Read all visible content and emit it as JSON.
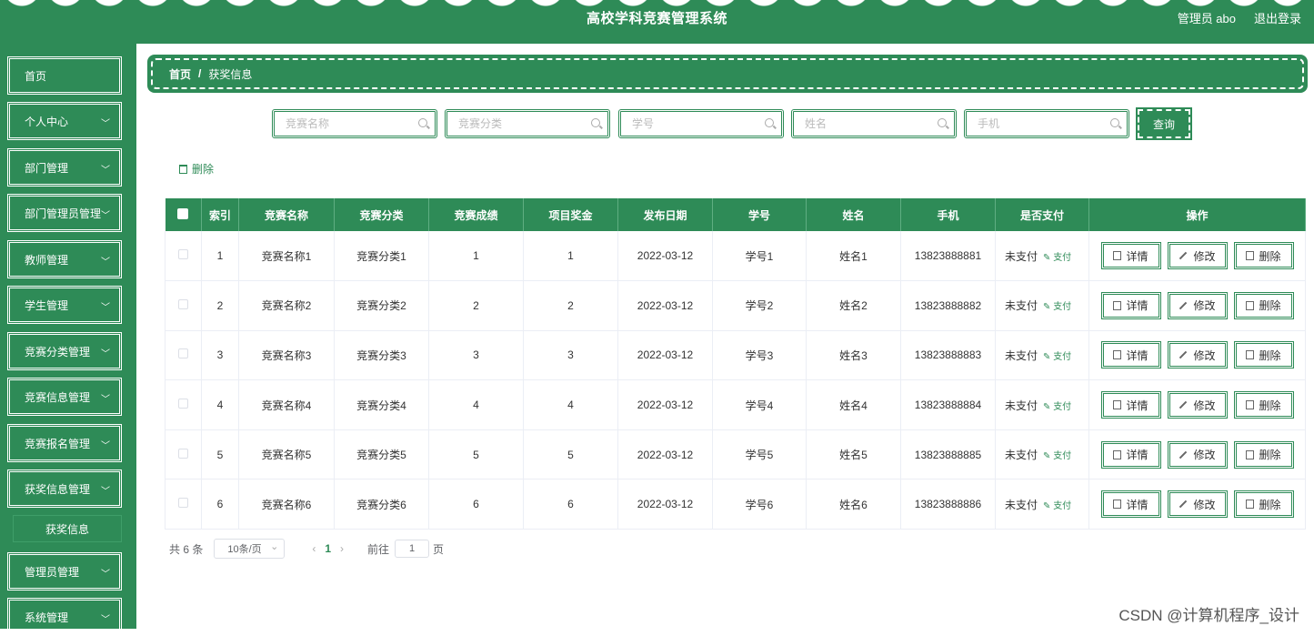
{
  "header": {
    "title": "高校学科竞赛管理系统",
    "user": "管理员 abo",
    "logout": "退出登录"
  },
  "sidebar": {
    "items": [
      {
        "label": "首页",
        "expandable": false
      },
      {
        "label": "个人中心",
        "expandable": true
      },
      {
        "label": "部门管理",
        "expandable": true
      },
      {
        "label": "部门管理员管理",
        "expandable": true
      },
      {
        "label": "教师管理",
        "expandable": true
      },
      {
        "label": "学生管理",
        "expandable": true
      },
      {
        "label": "竞赛分类管理",
        "expandable": true
      },
      {
        "label": "竞赛信息管理",
        "expandable": true
      },
      {
        "label": "竞赛报名管理",
        "expandable": true
      },
      {
        "label": "获奖信息管理",
        "expandable": true
      },
      {
        "label": "管理员管理",
        "expandable": true
      },
      {
        "label": "系统管理",
        "expandable": true
      }
    ],
    "active_sub": "获奖信息"
  },
  "breadcrumb": {
    "home": "首页",
    "separator": "/",
    "current": "获奖信息"
  },
  "search": {
    "fields": [
      {
        "placeholder": "竞赛名称"
      },
      {
        "placeholder": "竞赛分类"
      },
      {
        "placeholder": "学号"
      },
      {
        "placeholder": "姓名"
      },
      {
        "placeholder": "手机"
      }
    ],
    "query_label": "查询"
  },
  "bulk_delete_label": "删除",
  "table": {
    "headers": [
      "索引",
      "竞赛名称",
      "竞赛分类",
      "竞赛成绩",
      "项目奖金",
      "发布日期",
      "学号",
      "姓名",
      "手机",
      "是否支付",
      "操作"
    ],
    "rows": [
      {
        "index": "1",
        "name": "竞赛名称1",
        "category": "竞赛分类1",
        "score": "1",
        "bonus": "1",
        "date": "2022-03-12",
        "student_no": "学号1",
        "student_name": "姓名1",
        "phone": "13823888881",
        "paid": "未支付"
      },
      {
        "index": "2",
        "name": "竞赛名称2",
        "category": "竞赛分类2",
        "score": "2",
        "bonus": "2",
        "date": "2022-03-12",
        "student_no": "学号2",
        "student_name": "姓名2",
        "phone": "13823888882",
        "paid": "未支付"
      },
      {
        "index": "3",
        "name": "竞赛名称3",
        "category": "竞赛分类3",
        "score": "3",
        "bonus": "3",
        "date": "2022-03-12",
        "student_no": "学号3",
        "student_name": "姓名3",
        "phone": "13823888883",
        "paid": "未支付"
      },
      {
        "index": "4",
        "name": "竞赛名称4",
        "category": "竞赛分类4",
        "score": "4",
        "bonus": "4",
        "date": "2022-03-12",
        "student_no": "学号4",
        "student_name": "姓名4",
        "phone": "13823888884",
        "paid": "未支付"
      },
      {
        "index": "5",
        "name": "竞赛名称5",
        "category": "竞赛分类5",
        "score": "5",
        "bonus": "5",
        "date": "2022-03-12",
        "student_no": "学号5",
        "student_name": "姓名5",
        "phone": "13823888885",
        "paid": "未支付"
      },
      {
        "index": "6",
        "name": "竞赛名称6",
        "category": "竞赛分类6",
        "score": "6",
        "bonus": "6",
        "date": "2022-03-12",
        "student_no": "学号6",
        "student_name": "姓名6",
        "phone": "13823888886",
        "paid": "未支付"
      }
    ],
    "pay_label": "支付",
    "actions": {
      "detail": "详情",
      "edit": "修改",
      "delete": "删除"
    }
  },
  "pagination": {
    "total_text": "共 6 条",
    "page_size": "10条/页",
    "current_page": "1",
    "goto_label": "前往",
    "goto_value": "1",
    "page_suffix": "页"
  },
  "watermark": "CSDN @计算机程序_设计",
  "colors": {
    "primary": "#2e8b57",
    "white": "#ffffff"
  }
}
